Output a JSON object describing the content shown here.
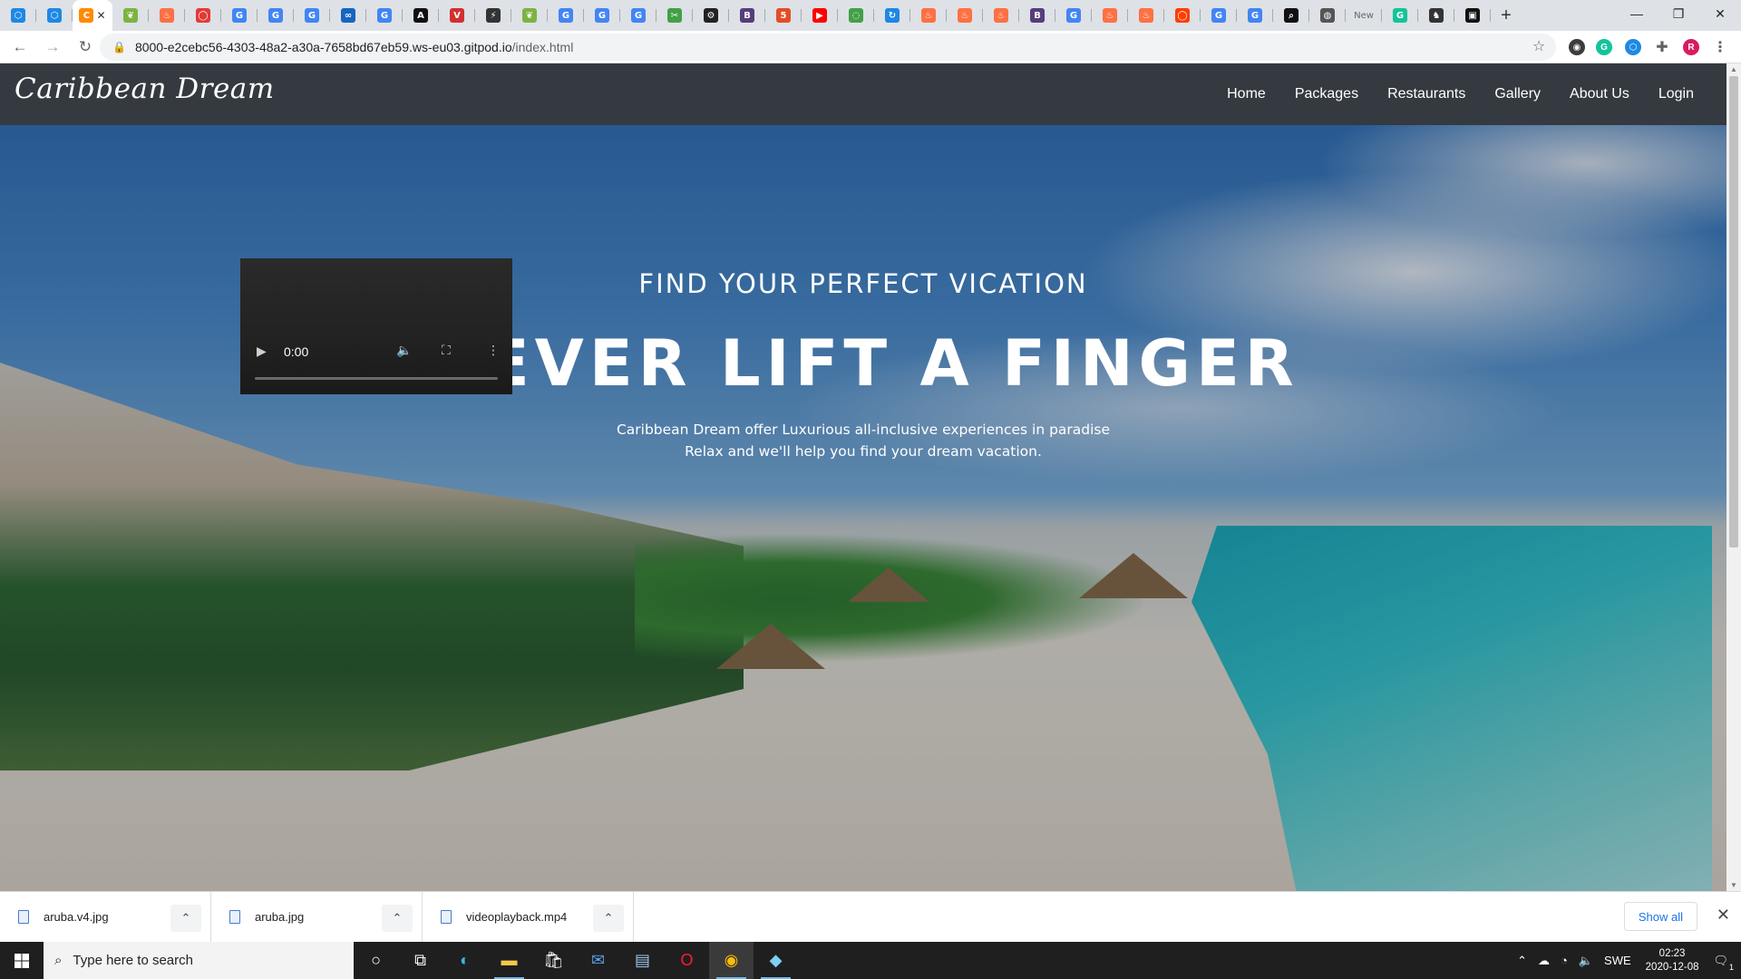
{
  "browser": {
    "tabs": [
      {
        "icon": "cube-icon",
        "color": "#1e88e5",
        "glyph": "⬡"
      },
      {
        "icon": "cube-icon",
        "color": "#1e88e5",
        "glyph": "⬡"
      },
      {
        "icon": "gitpod-icon",
        "color": "#ff8a00",
        "glyph": "C",
        "active": true
      },
      {
        "icon": "leaf-icon",
        "color": "#7cb342",
        "glyph": "❦"
      },
      {
        "icon": "flame-icon",
        "color": "#ff7043",
        "glyph": "♨"
      },
      {
        "icon": "ring-icon",
        "color": "#e53935",
        "glyph": "◯"
      },
      {
        "icon": "google-icon",
        "color": "#4285f4",
        "glyph": "G"
      },
      {
        "icon": "google-icon",
        "color": "#4285f4",
        "glyph": "G"
      },
      {
        "icon": "google-icon",
        "color": "#4285f4",
        "glyph": "G"
      },
      {
        "icon": "infinity-icon",
        "color": "#1565c0",
        "glyph": "∞"
      },
      {
        "icon": "google-icon",
        "color": "#4285f4",
        "glyph": "G"
      },
      {
        "icon": "a-icon",
        "color": "#111111",
        "glyph": "A"
      },
      {
        "icon": "v-icon",
        "color": "#d32f2f",
        "glyph": "V"
      },
      {
        "icon": "bolt-icon",
        "color": "#333333",
        "glyph": "⚡"
      },
      {
        "icon": "leaf-icon",
        "color": "#7cb342",
        "glyph": "❦"
      },
      {
        "icon": "google-icon",
        "color": "#4285f4",
        "glyph": "G"
      },
      {
        "icon": "google-icon",
        "color": "#4285f4",
        "glyph": "G"
      },
      {
        "icon": "google-icon",
        "color": "#4285f4",
        "glyph": "G"
      },
      {
        "icon": "tools-icon",
        "color": "#43a047",
        "glyph": "✂"
      },
      {
        "icon": "gear-icon",
        "color": "#222222",
        "glyph": "⚙"
      },
      {
        "icon": "b-icon",
        "color": "#563d7c",
        "glyph": "B"
      },
      {
        "icon": "html-icon",
        "color": "#e44d26",
        "glyph": "5"
      },
      {
        "icon": "youtube-icon",
        "color": "#ff0000",
        "glyph": "▶"
      },
      {
        "icon": "chat-icon",
        "color": "#43a047",
        "glyph": "◌"
      },
      {
        "icon": "refresh-icon",
        "color": "#1e88e5",
        "glyph": "↻"
      },
      {
        "icon": "flame-icon",
        "color": "#ff7043",
        "glyph": "♨"
      },
      {
        "icon": "flame-icon",
        "color": "#ff7043",
        "glyph": "♨"
      },
      {
        "icon": "flame-icon",
        "color": "#ff7043",
        "glyph": "♨"
      },
      {
        "icon": "b-icon",
        "color": "#563d7c",
        "glyph": "B"
      },
      {
        "icon": "google-icon",
        "color": "#4285f4",
        "glyph": "G"
      },
      {
        "icon": "flame-icon",
        "color": "#ff7043",
        "glyph": "♨"
      },
      {
        "icon": "flame-icon",
        "color": "#ff7043",
        "glyph": "♨"
      },
      {
        "icon": "ring-icon",
        "color": "#ff3d00",
        "glyph": "◯"
      },
      {
        "icon": "google-icon",
        "color": "#4285f4",
        "glyph": "G"
      },
      {
        "icon": "google-icon",
        "color": "#4285f4",
        "glyph": "G"
      },
      {
        "icon": "zoom-icon",
        "color": "#111111",
        "glyph": "⌕"
      },
      {
        "icon": "globe-icon",
        "color": "#555555",
        "glyph": "◍"
      },
      {
        "icon": "new-tab-icon",
        "color": "#666666",
        "glyph": "",
        "label": "New"
      },
      {
        "icon": "grammarly-icon",
        "color": "#15c39a",
        "glyph": "G"
      },
      {
        "icon": "wolf-icon",
        "color": "#333333",
        "glyph": "♞"
      },
      {
        "icon": "image-icon",
        "color": "#111111",
        "glyph": "▣"
      }
    ],
    "new_tab_label": "+",
    "url_host": "8000-e2cebc56-4303-48a2-a30a-7658bd67eb59.ws-eu03.gitpod.io",
    "url_path": "/index.html",
    "extensions": [
      {
        "icon": "star-icon",
        "glyph": "☆",
        "color": "#5f6368"
      },
      {
        "icon": "extension-dark-icon",
        "glyph": "◉",
        "color": "#3c3c3c"
      },
      {
        "icon": "grammarly-icon",
        "glyph": "G",
        "color": "#15c39a"
      },
      {
        "icon": "cube-icon",
        "glyph": "⬡",
        "color": "#1e88e5"
      },
      {
        "icon": "puzzle-icon",
        "glyph": "✚",
        "color": "#5f6368"
      },
      {
        "icon": "profile-avatar",
        "glyph": "R",
        "color": "#d81b60"
      },
      {
        "icon": "menu-kebab-icon",
        "glyph": "⋮",
        "color": "#5f6368"
      }
    ]
  },
  "site": {
    "brand": "Caribbean Dream",
    "nav": [
      "Home",
      "Packages",
      "Restaurants",
      "Gallery",
      "About Us",
      "Login"
    ],
    "tagline": "FIND YOUR PERFECT VICATION",
    "headline": "NEVER LIFT A FINGER",
    "sub1": "Caribbean Dream offer Luxurious all-inclusive experiences in paradise",
    "sub2": "Relax and we'll help you find your dream vacation.",
    "video": {
      "time": "0:00"
    }
  },
  "downloads": {
    "items": [
      "aruba.v4.jpg",
      "aruba.jpg",
      "videoplayback.mp4"
    ],
    "show_all": "Show all"
  },
  "taskbar": {
    "search_placeholder": "Type here to search",
    "language": "SWE",
    "time": "02:23",
    "date": "2020-12-08",
    "notifications": "1"
  }
}
